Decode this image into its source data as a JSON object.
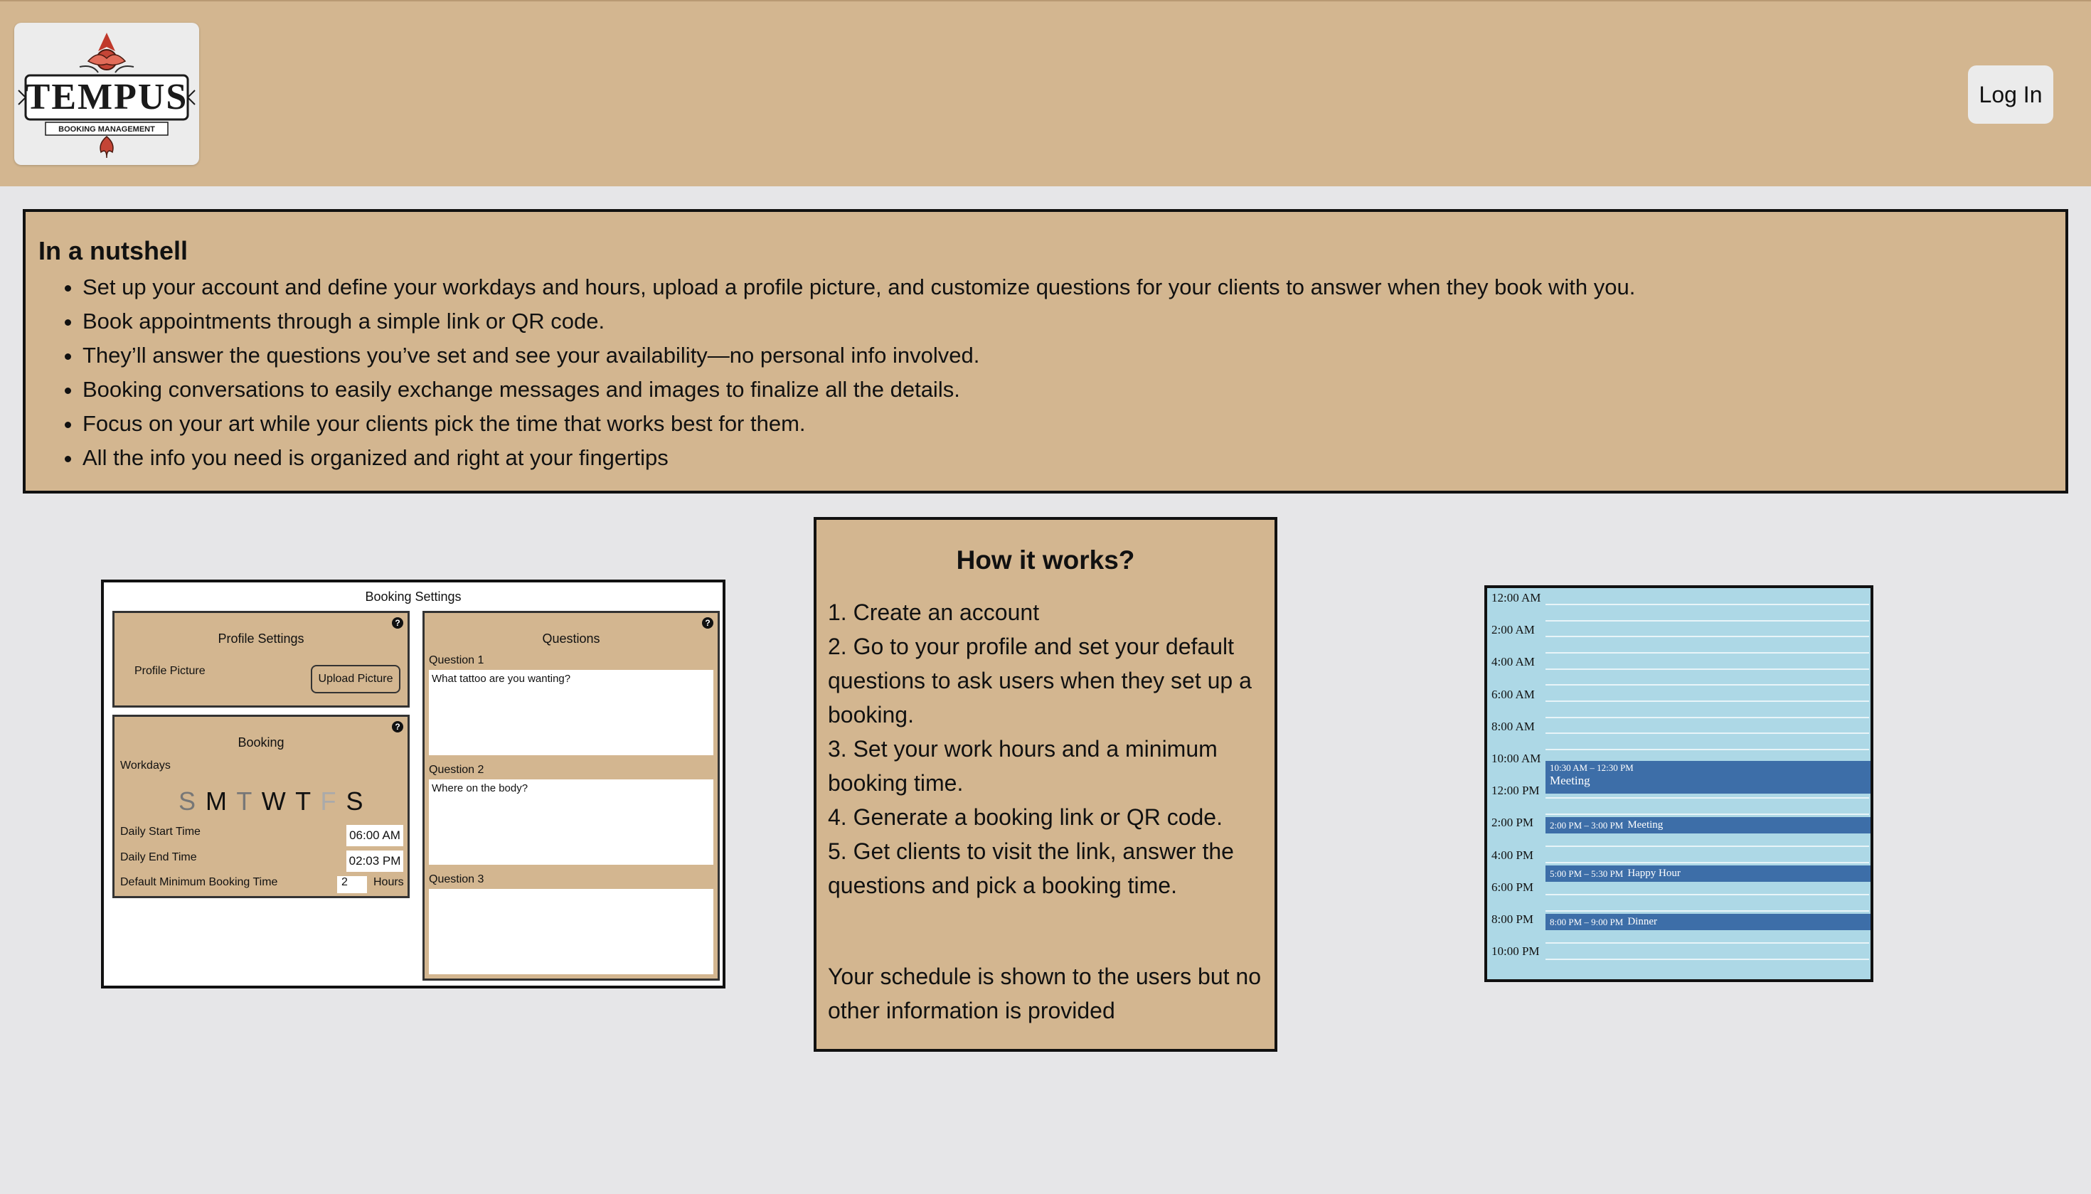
{
  "header": {
    "logo_text": "TEMPUS",
    "logo_subtext": "BOOKING MANAGEMENT",
    "login_label": "Log In"
  },
  "nutshell": {
    "title": "In a nutshell",
    "items": [
      "Set up your account and define your workdays and hours, upload a profile picture, and customize questions for your clients to answer when they book with you.",
      "Book appointments through a simple link or QR code.",
      "They’ll answer the questions you’ve set and see your availability—no personal info involved.",
      "Booking conversations to easily exchange messages and images to finalize all the details.",
      "Focus on your art while your clients pick the time that works best for them.",
      "All the info you need is organized and right at your fingertips"
    ]
  },
  "booking_settings": {
    "title": "Booking Settings",
    "profile_settings_title": "Profile Settings",
    "profile_picture_label": "Profile Picture",
    "upload_label": "Upload Picture",
    "booking_title": "Booking",
    "workdays_label": "Workdays",
    "days": [
      "S",
      "M",
      "T",
      "W",
      "T",
      "F",
      "S"
    ],
    "daily_start_label": "Daily Start Time",
    "daily_start_value": "06:00 AM",
    "daily_end_label": "Daily End Time",
    "daily_end_value": "02:03 PM",
    "min_booking_label": "Default Minimum Booking Time",
    "min_booking_value": "2",
    "hours_label": "Hours",
    "questions_title": "Questions",
    "questions": [
      {
        "label": "Question 1",
        "value": "What tattoo are you wanting?"
      },
      {
        "label": "Question 2",
        "value": "Where on the body?"
      },
      {
        "label": "Question 3",
        "value": ""
      }
    ]
  },
  "how_it_works": {
    "title": "How it works?",
    "steps": [
      "1. Create an account",
      "2. Go to your profile and set your default questions to ask users when they set up a booking.",
      "3. Set your work hours and a minimum booking time.",
      "4. Generate a booking link or QR code.",
      "5. Get clients to visit the link, answer the questions and pick a booking time."
    ],
    "note": "Your schedule is shown to the users but no other information is provided"
  },
  "calendar": {
    "hours": [
      "12:00 AM",
      "2:00 AM",
      "4:00 AM",
      "6:00 AM",
      "8:00 AM",
      "10:00 AM",
      "12:00 PM",
      "2:00 PM",
      "4:00 PM",
      "6:00 PM",
      "8:00 PM",
      "10:00 PM"
    ],
    "events": [
      {
        "time": "10:30 AM – 12:30 PM",
        "name": "Meeting"
      },
      {
        "time": "2:00 PM – 3:00 PM",
        "name": "Meeting"
      },
      {
        "time": "5:00 PM – 5:30 PM",
        "name": "Happy Hour"
      },
      {
        "time": "8:00 PM – 9:00 PM",
        "name": "Dinner"
      }
    ]
  },
  "colors": {
    "tan": "#d3b690",
    "background": "#e6e6e8",
    "calendar_bg": "#add8e6",
    "event_blue": "#3d6ea8"
  }
}
